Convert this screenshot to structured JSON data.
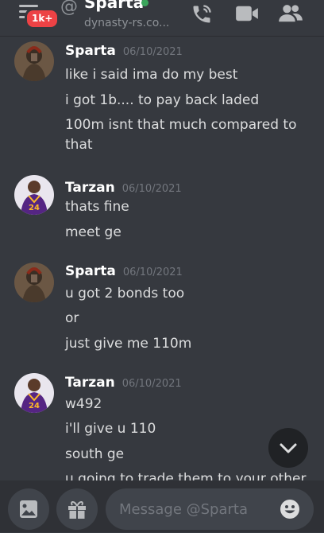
{
  "header": {
    "unread_badge": "1k+",
    "channel_name": "Sparta",
    "channel_sub": "dynasty-rs.co...",
    "at_symbol": "@"
  },
  "messages": [
    {
      "author": "Sparta",
      "timestamp": "06/10/2021",
      "avatar": "spartan-avatar",
      "lines": [
        "like i said ima do my best",
        "i got 1b.... to pay back laded",
        "100m isnt that much compared to",
        "that"
      ]
    },
    {
      "author": "Tarzan",
      "timestamp": "06/10/2021",
      "avatar": "lakers-24-avatar",
      "lines": [
        "thats fine",
        "meet ge"
      ]
    },
    {
      "author": "Sparta",
      "timestamp": "06/10/2021",
      "avatar": "spartan-avatar",
      "lines": [
        "u got 2 bonds too",
        "or",
        "just give me 110m"
      ]
    },
    {
      "author": "Tarzan",
      "timestamp": "06/10/2021",
      "avatar": "lakers-24-avatar",
      "lines": [
        "w492",
        "i'll give u 110",
        "south ge",
        "u going to trade them to your other"
      ]
    }
  ],
  "composer": {
    "placeholder": "Message @Sparta"
  },
  "icons": [
    "menu-icon",
    "call-icon",
    "video-icon",
    "members-icon",
    "image-icon",
    "gift-icon",
    "emoji-icon",
    "chevron-down-icon"
  ],
  "colors": {
    "background": "#36393f",
    "badge": "#ed4245",
    "online": "#3ba55c",
    "input": "#40444b"
  }
}
